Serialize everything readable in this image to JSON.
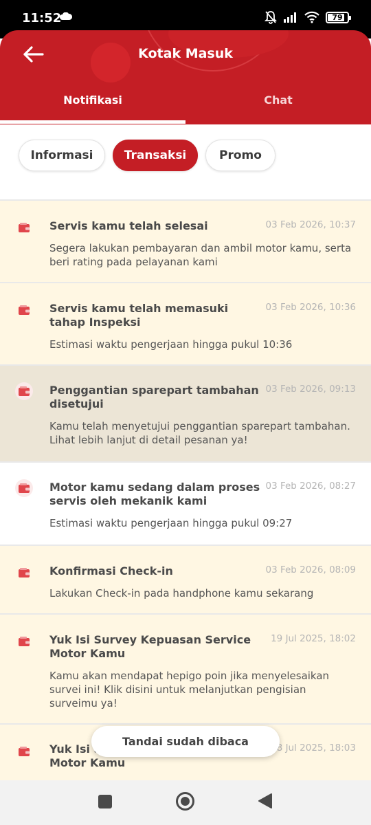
{
  "status_bar": {
    "time": "11:52",
    "battery": "79"
  },
  "header": {
    "title": "Kotak Masuk",
    "tabs": [
      {
        "label": "Notifikasi"
      },
      {
        "label": "Chat"
      }
    ]
  },
  "filters": [
    {
      "label": "Informasi"
    },
    {
      "label": "Transaksi"
    },
    {
      "label": "Promo"
    }
  ],
  "notifications": [
    {
      "title": "Servis kamu telah selesai",
      "date": "03 Feb 2026, 10:37",
      "desc": "Segera lakukan pembayaran dan ambil motor kamu, serta beri rating pada pelayanan kami"
    },
    {
      "title": "Servis kamu telah memasuki tahap Inspeksi",
      "date": "03 Feb 2026, 10:36",
      "desc": "Estimasi waktu pengerjaan hingga pukul 10:36"
    },
    {
      "title": "Penggantian sparepart tambahan disetujui",
      "date": "03 Feb 2026, 09:13",
      "desc": "Kamu telah menyetujui penggantian sparepart tambahan. Lihat lebih lanjut di detail pesanan ya!"
    },
    {
      "title": "Motor kamu sedang dalam proses servis oleh mekanik kami",
      "date": "03 Feb 2026, 08:27",
      "desc": "Estimasi waktu pengerjaan hingga pukul 09:27"
    },
    {
      "title": "Konfirmasi Check-in",
      "date": "03 Feb 2026, 08:09",
      "desc": "Lakukan Check-in pada handphone kamu sekarang"
    },
    {
      "title": "Yuk Isi Survey Kepuasan Service Motor Kamu",
      "date": "19 Jul 2025, 18:02",
      "desc": "Kamu akan mendapat hepigo poin jika menyelesaikan survei ini! Klik disini untuk melanjutkan pengisian surveimu ya!"
    },
    {
      "title": "Yuk Isi Survey Kepuasan Service Motor Kamu",
      "date": "18 Jul 2025, 18:03",
      "desc": ""
    }
  ],
  "mark_read_label": "Tandai sudah dibaca",
  "colors": {
    "brand_red": "#c41e25",
    "unread_bg": "#fff7e3",
    "pressed_bg": "#ece5d6"
  }
}
